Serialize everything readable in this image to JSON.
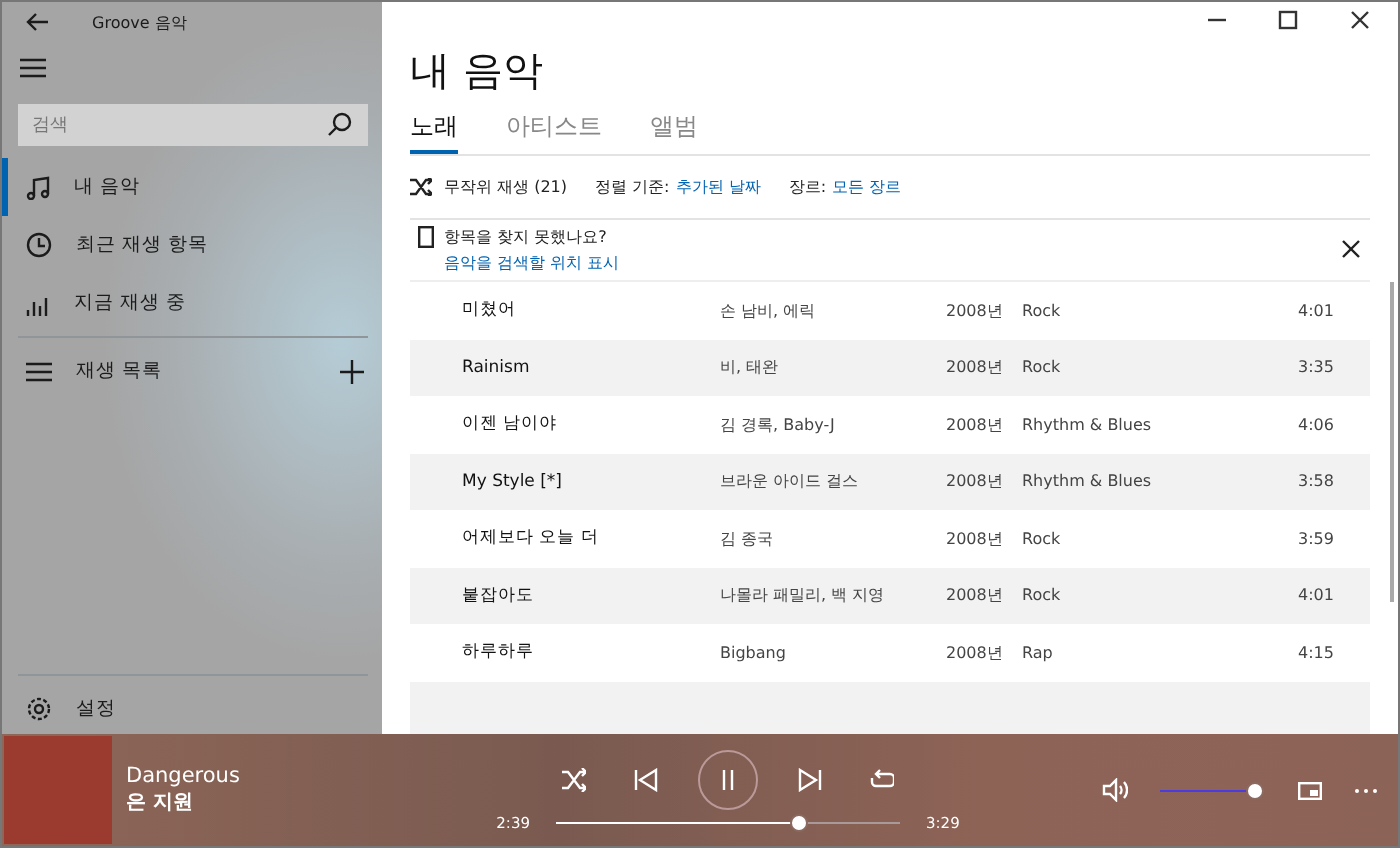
{
  "window": {
    "title": "Groove 음악"
  },
  "sidebar": {
    "search": {
      "placeholder": "검색"
    },
    "items": [
      {
        "label": "내 음악",
        "kind": "note",
        "selected": true
      },
      {
        "label": "최근 재생 항목",
        "kind": "clock",
        "selected": false
      },
      {
        "label": "지금 재생 중",
        "kind": "bars",
        "selected": false
      }
    ],
    "playlists": {
      "label": "재생 목록"
    },
    "settings": {
      "label": "설정"
    }
  },
  "page": {
    "title": "내 음악",
    "tabs": [
      {
        "label": "노래",
        "selected": true
      },
      {
        "label": "아티스트",
        "selected": false
      },
      {
        "label": "앨범",
        "selected": false
      }
    ],
    "toolbar": {
      "shuffle": "무작위 재생 (21)",
      "sort_label": "정렬 기준:",
      "sort_value": "추가된 날짜",
      "genre_label": "장르:",
      "genre_value": "모든 장르"
    },
    "notice": {
      "title": "항목을 찾지 못했나요?",
      "link": "음악을 검색할 위치 표시"
    },
    "songs": [
      {
        "title": "미쳤어",
        "artist": "손 남비, 에릭",
        "year": "2008년",
        "genre": "Rock",
        "duration": "4:01"
      },
      {
        "title": "Rainism",
        "artist": "비, 태완",
        "year": "2008년",
        "genre": "Rock",
        "duration": "3:35"
      },
      {
        "title": "이젠 남이야",
        "artist": "김 경록, Baby-J",
        "year": "2008년",
        "genre": "Rhythm & Blues",
        "duration": "4:06"
      },
      {
        "title": "My Style [*]",
        "artist": "브라운 아이드 걸스",
        "year": "2008년",
        "genre": "Rhythm & Blues",
        "duration": "3:58"
      },
      {
        "title": "어제보다 오늘 더",
        "artist": "김 종국",
        "year": "2008년",
        "genre": "Rock",
        "duration": "3:59"
      },
      {
        "title": "붙잡아도",
        "artist": "나몰라 패밀리, 백 지영",
        "year": "2008년",
        "genre": "Rock",
        "duration": "4:01"
      },
      {
        "title": "하루하루",
        "artist": "Bigbang",
        "year": "2008년",
        "genre": "Rap",
        "duration": "4:15"
      }
    ]
  },
  "player": {
    "track": "Dangerous",
    "artist": "은 지원",
    "elapsed": "2:39",
    "total": "3:29",
    "progress": {
      "level": 0.72
    },
    "volume": {
      "level": 1
    }
  }
}
